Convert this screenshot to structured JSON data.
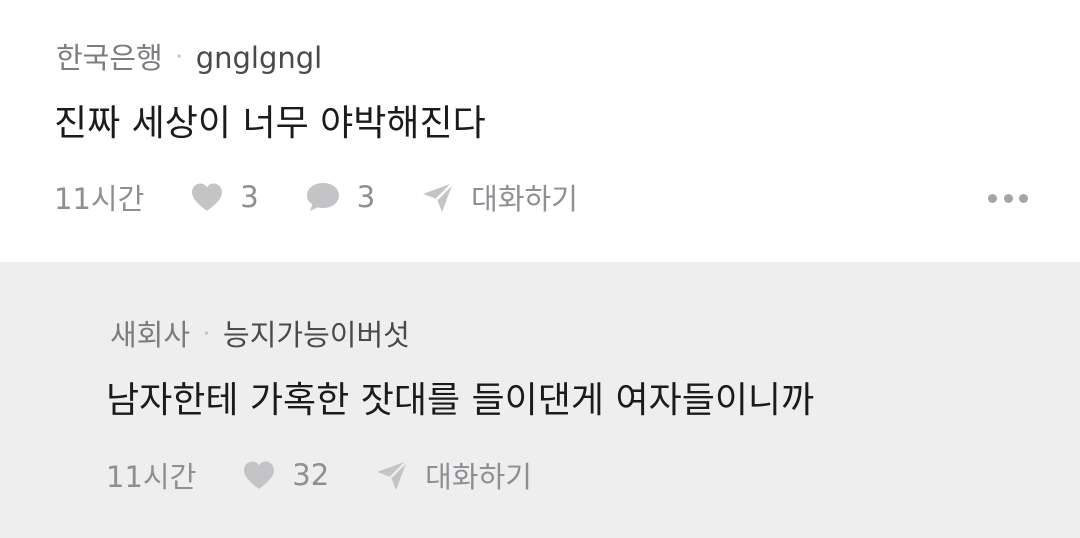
{
  "comments": [
    {
      "org": "한국은행",
      "nickname": "gnglgngl",
      "text": "진짜 세상이 너무 야박해진다",
      "time": "11시간",
      "likes": "3",
      "replies": "3",
      "conversation_label": "대화하기"
    },
    {
      "org": "새회사",
      "nickname": "능지가능이버섯",
      "text": "남자한테 가혹한 잣대를 들이댄게 여자들이니까",
      "time": "11시간",
      "likes": "32",
      "conversation_label": "대화하기"
    }
  ],
  "separator": "·",
  "colors": {
    "top_background": "#ffffff",
    "reply_background": "#eeeeef",
    "icon": "#c4c4c7",
    "meta_text": "#7c7c80"
  },
  "icons": [
    "heart-icon",
    "comment-bubble-icon",
    "send-icon",
    "more-icon"
  ]
}
